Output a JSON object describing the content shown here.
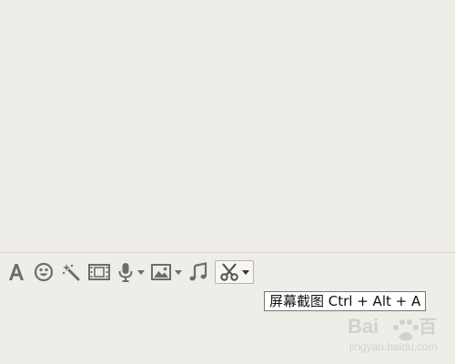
{
  "toolbar": {
    "items": [
      {
        "icon": "font-icon",
        "has_dropdown": false
      },
      {
        "icon": "emoji-icon",
        "has_dropdown": false
      },
      {
        "icon": "magic-wand-icon",
        "has_dropdown": false
      },
      {
        "icon": "film-icon",
        "has_dropdown": false
      },
      {
        "icon": "microphone-icon",
        "has_dropdown": true
      },
      {
        "icon": "image-icon",
        "has_dropdown": true
      },
      {
        "icon": "music-icon",
        "has_dropdown": false
      },
      {
        "icon": "scissors-icon",
        "has_dropdown": true,
        "active": true
      }
    ]
  },
  "tooltip": {
    "text": "屏幕截图 Ctrl + Alt + A"
  },
  "colors": {
    "background": "#efede8",
    "icon": "#6c6c6c",
    "tooltip_border": "#767676"
  }
}
